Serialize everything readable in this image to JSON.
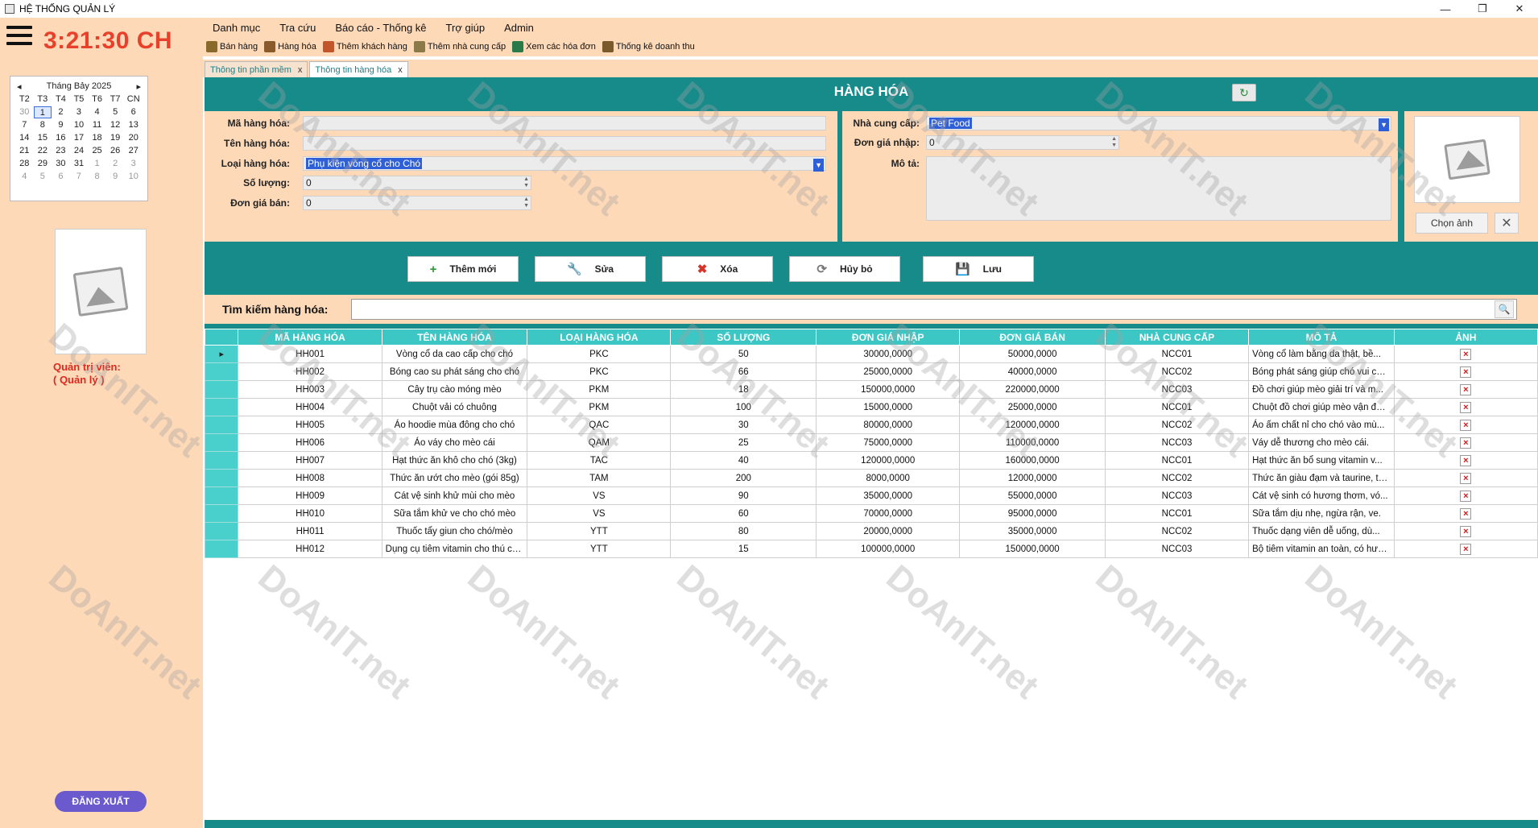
{
  "window": {
    "title": "HỆ THỐNG QUẢN LÝ",
    "controls": [
      "—",
      "❐",
      "✕"
    ]
  },
  "sidebar": {
    "clock": "3:21:30 CH",
    "calendar": {
      "month_label": "Tháng Bảy 2025",
      "weekdays": [
        "T2",
        "T3",
        "T4",
        "T5",
        "T6",
        "T7",
        "CN"
      ],
      "weeks": [
        [
          "30",
          "1",
          "2",
          "3",
          "4",
          "5",
          "6"
        ],
        [
          "7",
          "8",
          "9",
          "10",
          "11",
          "12",
          "13"
        ],
        [
          "14",
          "15",
          "16",
          "17",
          "18",
          "19",
          "20"
        ],
        [
          "21",
          "22",
          "23",
          "24",
          "25",
          "26",
          "27"
        ],
        [
          "28",
          "29",
          "30",
          "31",
          "1",
          "2",
          "3"
        ],
        [
          "4",
          "5",
          "6",
          "7",
          "8",
          "9",
          "10"
        ]
      ]
    },
    "role_label": "Quản trị viên:",
    "role_name": "( Quản lý )",
    "logout_label": "ĐĂNG XUẤT"
  },
  "menu": [
    "Danh mục",
    "Tra cứu",
    "Báo cáo - Thống kê",
    "Trợ giúp",
    "Admin"
  ],
  "toolbar": [
    {
      "label": "Bán hàng",
      "icon": "cart-icon",
      "color": "#8a6a2a"
    },
    {
      "label": "Hàng hóa",
      "icon": "box-icon",
      "color": "#8a5a2a"
    },
    {
      "label": "Thêm khách hàng",
      "icon": "user-add-icon",
      "color": "#c2562a"
    },
    {
      "label": "Thêm nhà cung cấp",
      "icon": "truck-icon",
      "color": "#8a7a4a"
    },
    {
      "label": "Xem các hóa đơn",
      "icon": "invoice-icon",
      "color": "#2a7a4a"
    },
    {
      "label": "Thống kê doanh thu",
      "icon": "chart-icon",
      "color": "#7a5a2a"
    }
  ],
  "tabs": [
    {
      "label": "Thông tin phần mềm",
      "close": "x"
    },
    {
      "label": "Thông tin hàng hóa",
      "close": "x"
    }
  ],
  "page": {
    "title": "HÀNG HÓA",
    "form": {
      "ma_label": "Mã hàng hóa:",
      "ma_value": "",
      "ten_label": "Tên hàng hóa:",
      "ten_value": "",
      "loai_label": "Loại hàng hóa:",
      "loai_value": "Phụ kiện vòng cổ cho Chó",
      "soluong_label": "Số lượng:",
      "soluong_value": "0",
      "dongiaban_label": "Đơn giá bán:",
      "dongiaban_value": "0",
      "ncc_label": "Nhà cung cấp:",
      "ncc_value": "Pet Food",
      "dongianhap_label": "Đơn giá nhập:",
      "dongianhap_value": "0",
      "mota_label": "Mô tả:",
      "chon_anh": "Chọn ảnh"
    },
    "actions": [
      {
        "label": "Thêm mới",
        "icon": "+",
        "color": "#2a9a3a",
        "name": "add-button"
      },
      {
        "label": "Sửa",
        "icon": "🔧",
        "color": "#777777",
        "name": "edit-button"
      },
      {
        "label": "Xóa",
        "icon": "✖",
        "color": "#d8352a",
        "name": "delete-button"
      },
      {
        "label": "Hủy bỏ",
        "icon": "⟳",
        "color": "#777777",
        "name": "cancel-button"
      },
      {
        "label": "Lưu",
        "icon": "💾",
        "color": "#555555",
        "name": "save-button"
      }
    ],
    "search_label": "Tìm kiếm hàng hóa:",
    "search_value": "",
    "grid": {
      "headers": [
        "MÃ HÀNG HÓA",
        "TÊN HÀNG HÓA",
        "LOẠI HÀNG HÓA",
        "SỐ LƯỢNG",
        "ĐƠN GIÁ NHẬP",
        "ĐƠN GIÁ BÁN",
        "NHÀ CUNG CẤP",
        "MÔ TẢ",
        "ẢNH"
      ],
      "rows": [
        [
          "HH001",
          "Vòng cổ da cao cấp cho chó",
          "PKC",
          "50",
          "30000,0000",
          "50000,0000",
          "NCC01",
          "Vòng cổ làm bằng da thật, bề..."
        ],
        [
          "HH002",
          "Bóng cao su phát sáng cho chó",
          "PKC",
          "66",
          "25000,0000",
          "40000,0000",
          "NCC02",
          "Bóng phát sáng giúp chó vui chơi ..."
        ],
        [
          "HH003",
          "Cây trụ cào móng mèo",
          "PKM",
          "18",
          "150000,0000",
          "220000,0000",
          "NCC03",
          "Đồ chơi giúp mèo giải trí và m..."
        ],
        [
          "HH004",
          "Chuột vải có chuông",
          "PKM",
          "100",
          "15000,0000",
          "25000,0000",
          "NCC01",
          "Chuột đồ chơi giúp mèo vận động."
        ],
        [
          "HH005",
          "Áo hoodie mùa đông cho chó",
          "QAC",
          "30",
          "80000,0000",
          "120000,0000",
          "NCC02",
          "Áo ấm chất nỉ cho chó vào mù..."
        ],
        [
          "HH006",
          "Áo váy cho mèo cái",
          "QAM",
          "25",
          "75000,0000",
          "110000,0000",
          "NCC03",
          "Váy dễ thương cho mèo cái."
        ],
        [
          "HH007",
          "Hạt thức ăn khô cho chó (3kg)",
          "TAC",
          "40",
          "120000,0000",
          "160000,0000",
          "NCC01",
          "Hạt thức ăn bổ sung vitamin v..."
        ],
        [
          "HH008",
          "Thức ăn ướt cho mèo (gói 85g)",
          "TAM",
          "200",
          "8000,0000",
          "12000,0000",
          "NCC02",
          "Thức ăn giàu đạm và taurine, tốt ..."
        ],
        [
          "HH009",
          "Cát vệ sinh khử mùi cho mèo",
          "VS",
          "90",
          "35000,0000",
          "55000,0000",
          "NCC03",
          "Cát vệ sinh có hương thơm, vó..."
        ],
        [
          "HH010",
          "Sữa tắm khử ve cho chó mèo",
          "VS",
          "60",
          "70000,0000",
          "95000,0000",
          "NCC01",
          "Sữa tắm dịu nhẹ, ngừa rận, ve."
        ],
        [
          "HH011",
          "Thuốc tẩy giun cho chó/mèo",
          "YTT",
          "80",
          "20000,0000",
          "35000,0000",
          "NCC02",
          "Thuốc dạng viên dễ uống, dù..."
        ],
        [
          "HH012",
          "Dụng cụ tiêm vitamin cho thú cưng",
          "YTT",
          "15",
          "100000,0000",
          "150000,0000",
          "NCC03",
          "Bộ tiêm vitamin an toàn, có hướng..."
        ]
      ]
    }
  },
  "watermark": "DoAnIT.net",
  "colors": {
    "teal": "#178a8a",
    "header_teal": "#3cc6c4",
    "peach": "#fdd9b8",
    "clock_red": "#e8402a",
    "logout": "#6a5acd"
  }
}
